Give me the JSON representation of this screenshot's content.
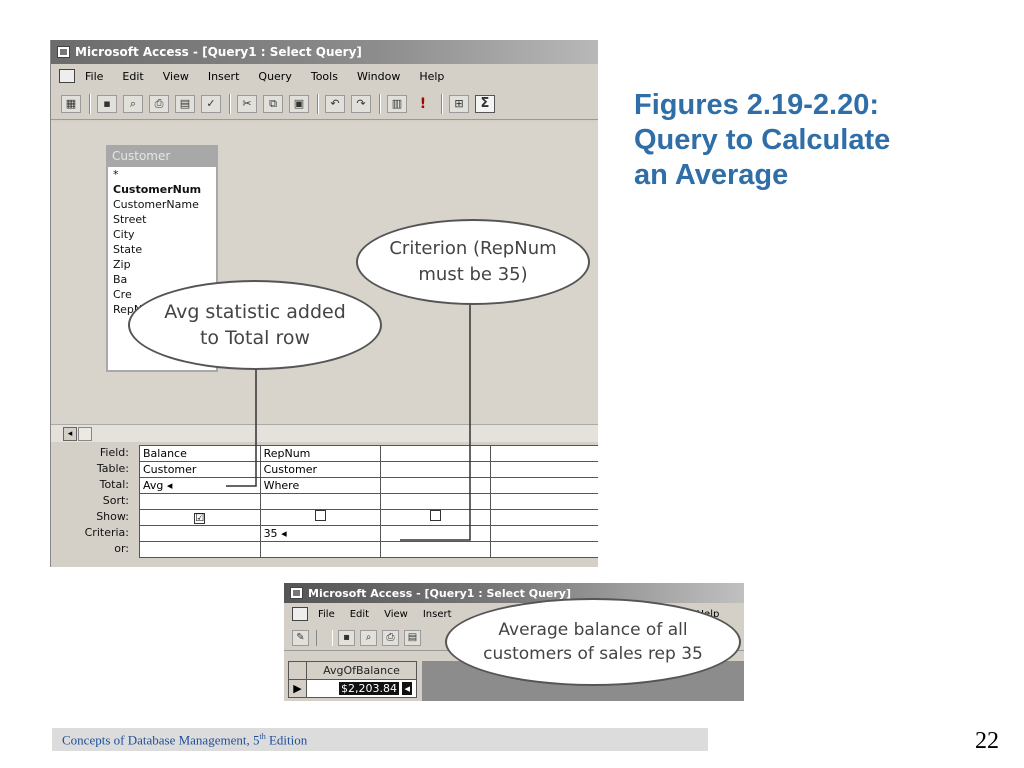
{
  "slide": {
    "title_lines": [
      "Figures 2.19-2.20:",
      "Query to Calculate",
      "an Average"
    ],
    "footer_text": "Concepts of Database Management, 5",
    "footer_sup": "th",
    "footer_suffix": " Edition",
    "page_number": "22"
  },
  "query_window": {
    "title": "Microsoft Access - [Query1 : Select Query]",
    "menu": [
      "File",
      "Edit",
      "View",
      "Insert",
      "Query",
      "Tools",
      "Window",
      "Help"
    ],
    "field_list": {
      "table_name": "Customer",
      "fields": [
        "*",
        "CustomerNum",
        "CustomerName",
        "Street",
        "City",
        "State",
        "Zip",
        "Ba",
        "Cre",
        "RepNum"
      ]
    },
    "grid": {
      "row_labels": [
        "Field:",
        "Table:",
        "Total:",
        "Sort:",
        "Show:",
        "Criteria:",
        "or:"
      ],
      "columns": [
        {
          "field": "Balance",
          "table": "Customer",
          "total": "Avg",
          "sort": "",
          "show": true,
          "criteria": ""
        },
        {
          "field": "RepNum",
          "table": "Customer",
          "total": "Where",
          "sort": "",
          "show": false,
          "criteria": "35"
        },
        {
          "field": "",
          "table": "",
          "total": "",
          "sort": "",
          "show": false,
          "criteria": ""
        },
        {
          "field": "",
          "table": "",
          "total": "",
          "sort": "",
          "show": false,
          "criteria": ""
        }
      ]
    }
  },
  "callouts": {
    "avg_line1": "Avg statistic added",
    "avg_line2": "to Total row",
    "criterion_line1": "Criterion (RepNum",
    "criterion_line2": "must be 35)",
    "result_line1": "Average balance of all",
    "result_line2": "customers of sales rep 35"
  },
  "result_window": {
    "title": "Microsoft Access - [Query1 : Select Query]",
    "menu": [
      "File",
      "Edit",
      "View",
      "Insert",
      "Help"
    ],
    "column_header": "AvgOfBalance",
    "value": "$2,203.84",
    "record_selector": "▶"
  },
  "icons": {
    "checked": "☑",
    "unchecked": "☐",
    "arrow": "◂"
  }
}
